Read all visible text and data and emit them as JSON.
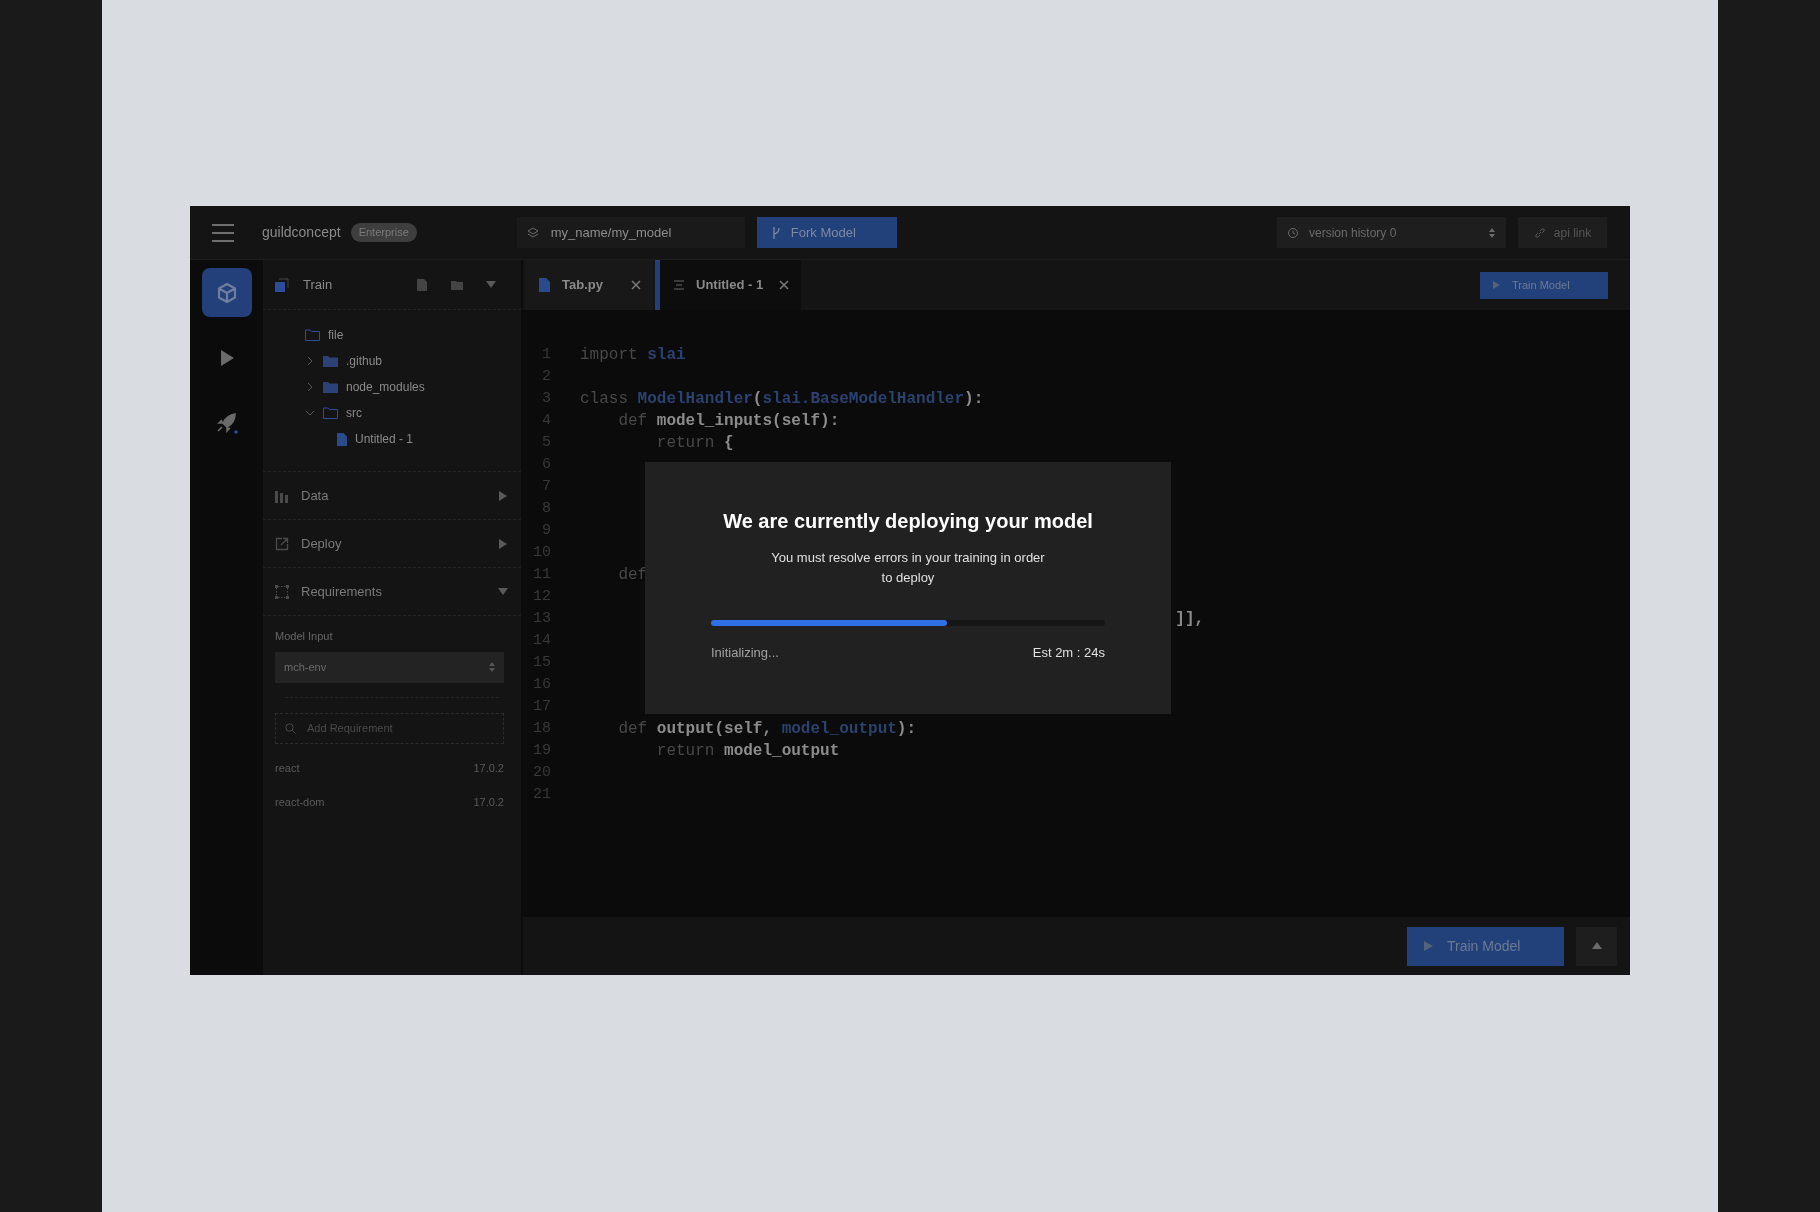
{
  "topbar": {
    "brand": "guildconcept",
    "badge": "Enterprise",
    "model_path": "my_name/my_model",
    "fork_button": "Fork Model",
    "version_select": "version history 0",
    "api_link": "api link"
  },
  "rail": [
    {
      "kind": "cube",
      "selected": true
    },
    {
      "kind": "play",
      "selected": false
    },
    {
      "kind": "rocket",
      "selected": false
    }
  ],
  "sidebar": {
    "title": "Train",
    "tree": [
      {
        "label": "file",
        "kind": "folder",
        "expanded": true,
        "children": [
          {
            "label": ".github",
            "kind": "folder",
            "expanded": false
          },
          {
            "label": "node_modules",
            "kind": "folder",
            "expanded": false
          },
          {
            "label": "src",
            "kind": "folder",
            "expanded": true,
            "children": [
              {
                "label": "Untitled - 1",
                "kind": "file"
              }
            ]
          }
        ]
      }
    ],
    "sections": [
      {
        "title": "Data",
        "kind": "chart",
        "expanded": false
      },
      {
        "title": "Deploy",
        "kind": "export",
        "expanded": false
      },
      {
        "title": "Requirements",
        "kind": "nodes",
        "expanded": true
      }
    ],
    "requirements": {
      "model_input_label": "Model Input",
      "model_input": "mch-env",
      "search_placeholder": "Add Requirement",
      "packages": [
        {
          "name": "react",
          "version": "17.0.2"
        },
        {
          "name": "react-dom",
          "version": "17.0.2"
        }
      ]
    }
  },
  "editor": {
    "tabs": [
      {
        "label": "Tab.py",
        "kind": "python",
        "selected": false
      },
      {
        "label": "Untitled - 1",
        "kind": "text",
        "selected": true
      }
    ],
    "train_button": "Train Model",
    "lines": [
      {
        "n": "1",
        "tokens": [
          {
            "kind": "kw",
            "text": "import "
          },
          {
            "kind": "name",
            "text": "slai"
          }
        ]
      },
      {
        "n": "2"
      },
      {
        "n": "3",
        "tokens": [
          {
            "kind": "kw",
            "text": "class "
          },
          {
            "kind": "name",
            "text": "ModelHandler"
          },
          {
            "kind": "plain",
            "text": "("
          },
          {
            "kind": "name",
            "text": "slai.BaseModelHandler"
          },
          {
            "kind": "plain",
            "text": "):"
          }
        ]
      },
      {
        "n": "4",
        "tokens": [
          {
            "kind": "kw",
            "text": "    def "
          },
          {
            "kind": "plain",
            "text": "model_inputs(self):"
          }
        ]
      },
      {
        "n": "5",
        "tokens": [
          {
            "kind": "kw",
            "text": "        return "
          },
          {
            "kind": "plain",
            "text": "{"
          }
        ]
      },
      {
        "n": "6"
      },
      {
        "n": "7"
      },
      {
        "n": "8"
      },
      {
        "n": "9"
      },
      {
        "n": "10"
      },
      {
        "n": "11",
        "tokens": [
          {
            "kind": "kw",
            "text": "    def"
          }
        ]
      },
      {
        "n": "12"
      },
      {
        "n": "13",
        "tokens": [
          {
            "kind": "plain",
            "text": "                                                              ]],"
          }
        ]
      },
      {
        "n": "14"
      },
      {
        "n": "15"
      },
      {
        "n": "16"
      },
      {
        "n": "17"
      },
      {
        "n": "18",
        "tokens": [
          {
            "kind": "kw",
            "text": "    def "
          },
          {
            "kind": "plain",
            "text": "output(self, "
          },
          {
            "kind": "name",
            "text": "model_output"
          },
          {
            "kind": "plain",
            "text": "):"
          }
        ]
      },
      {
        "n": "19",
        "tokens": [
          {
            "kind": "kw",
            "text": "        return "
          },
          {
            "kind": "plain",
            "text": "model_output"
          }
        ]
      },
      {
        "n": "20"
      },
      {
        "n": "21"
      }
    ]
  },
  "bottom_bar": {
    "train_button": "Train Model"
  },
  "modal": {
    "title": "We are currently deploying your model",
    "message": "You must resolve errors in your training in order to deploy",
    "level": 0.6,
    "status": "Initializing...",
    "estimate": "Est 2m : 24s"
  }
}
